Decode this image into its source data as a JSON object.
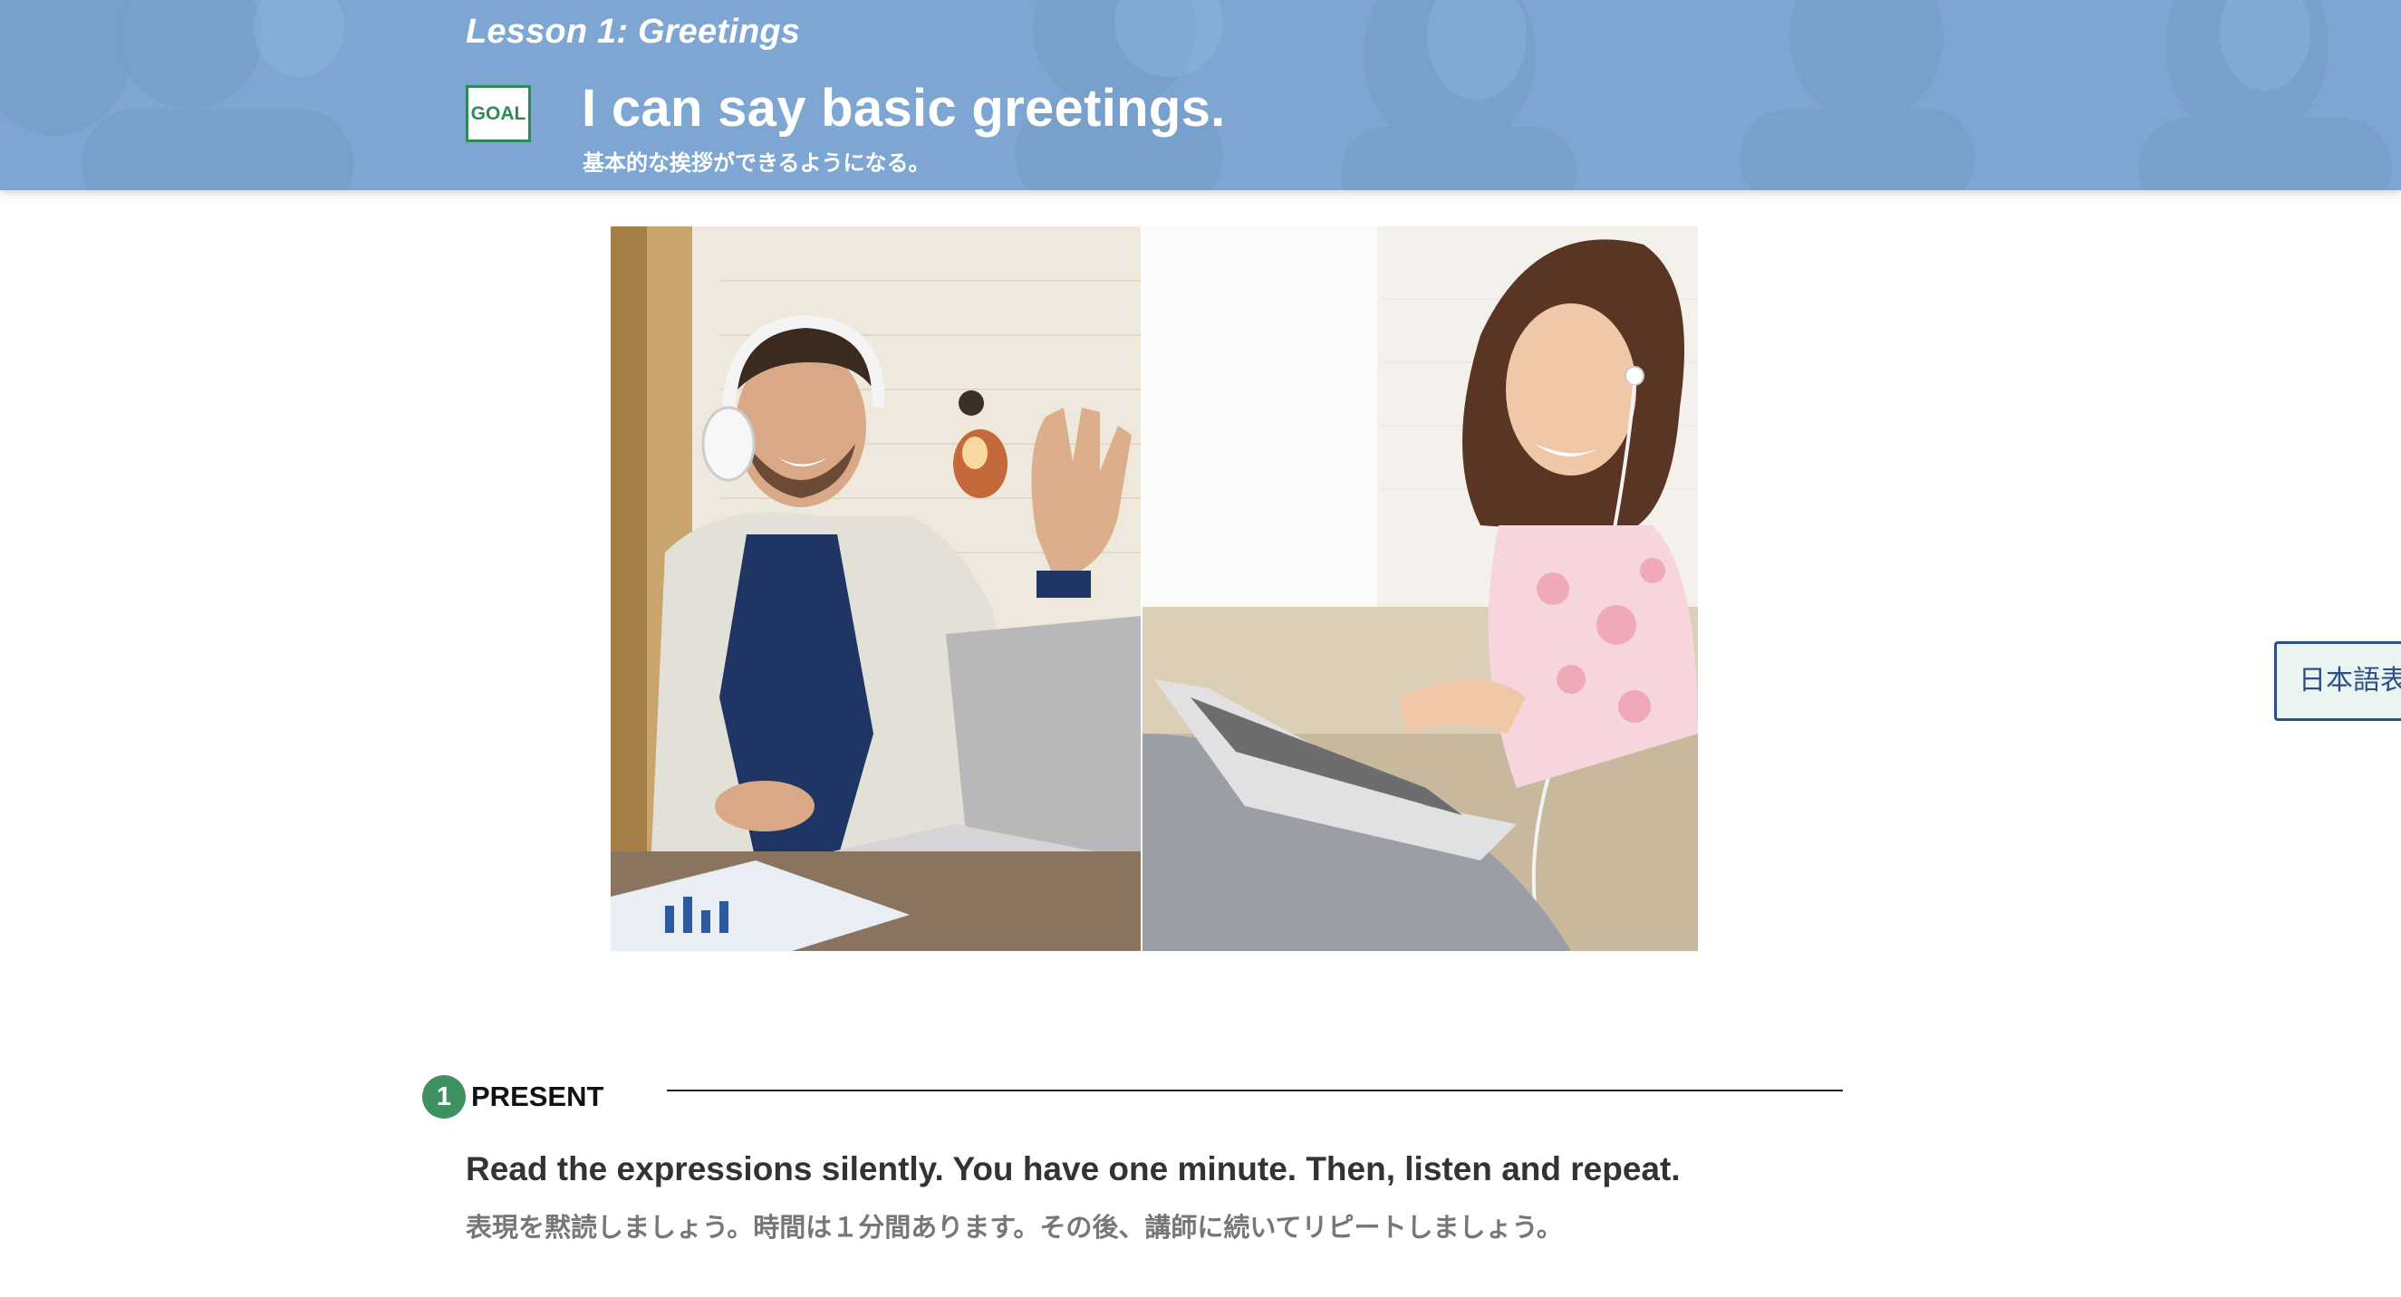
{
  "header": {
    "lesson_title": "Lesson 1: Greetings",
    "goal_badge": "GOAL",
    "goal_title": "I can say basic greetings.",
    "goal_subtitle": "基本的な挨拶ができるようになる。"
  },
  "hero": {
    "description_left": "smiling man with headphones waving at laptop",
    "description_right": "smiling woman with earphones typing on laptop"
  },
  "side_toggle": {
    "label": "日本語表示"
  },
  "section1": {
    "number": "1",
    "title": "PRESENT",
    "instruction": "Read the expressions silently. You have one minute. Then, listen and repeat.",
    "instruction_jp": "表現を黙読しましょう。時間は１分間あります。その後、講師に続いてリピートしましょう。"
  },
  "colors": {
    "banner": "#7fa8d3",
    "goal_green": "#2e8b57",
    "step_green": "#3e9160",
    "toggle_border": "#2c4f86",
    "toggle_bg": "#eaf4f1"
  }
}
